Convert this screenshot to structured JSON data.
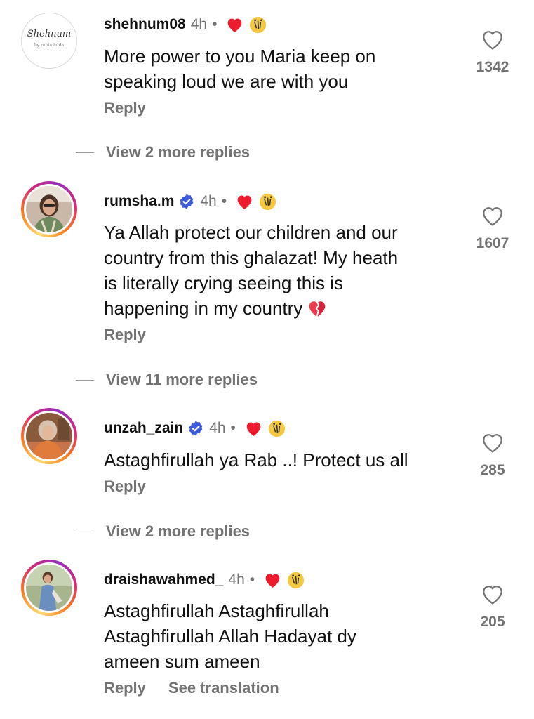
{
  "comments": [
    {
      "username": "shehnum08",
      "verified": false,
      "avatar_style": "logo",
      "avatar_logo": "Shehnum",
      "avatar_logo_sub": "by rubia huda",
      "time": "4h",
      "separator": "•",
      "lines": [
        "More power to you Maria keep on",
        "speaking loud we are with you"
      ],
      "reply_label": "Reply",
      "likes": "1342",
      "view_replies": "View 2 more replies"
    },
    {
      "username": "rumsha.m",
      "verified": true,
      "avatar_style": "story",
      "time": "4h",
      "separator": "•",
      "lines": [
        "Ya Allah protect our children and our",
        "country from this ghalazat! My heath",
        "is literally crying seeing this is",
        "happening in my country"
      ],
      "trailing_emoji": "broken-heart-emoji",
      "reply_label": "Reply",
      "likes": "1607",
      "view_replies": "View 11 more replies"
    },
    {
      "username": "unzah_zain",
      "verified": true,
      "avatar_style": "story",
      "time": "4h",
      "separator": "•",
      "lines": [
        "Astaghfirullah ya Rab ..! Protect us all"
      ],
      "reply_label": "Reply",
      "likes": "285",
      "view_replies": "View 2 more replies"
    },
    {
      "username": "draishawahmed_",
      "verified": false,
      "avatar_style": "story",
      "time": "4h",
      "separator": "•",
      "lines": [
        "Astaghfirullah Astaghfirullah",
        "Astaghfirullah Allah Hadayat dy",
        "ameen sum ameen"
      ],
      "reply_label": "Reply",
      "translate_label": "See translation",
      "likes": "205"
    }
  ],
  "icons": {
    "like": "heart-outline-icon",
    "verified": "verified-badge-icon",
    "creator_like": "red-heart-icon",
    "sticker": "sticker-badge-icon"
  },
  "colors": {
    "text": "#111111",
    "muted": "#737373",
    "verified": "#3b5bdb",
    "heart": "#ed1b2e"
  }
}
